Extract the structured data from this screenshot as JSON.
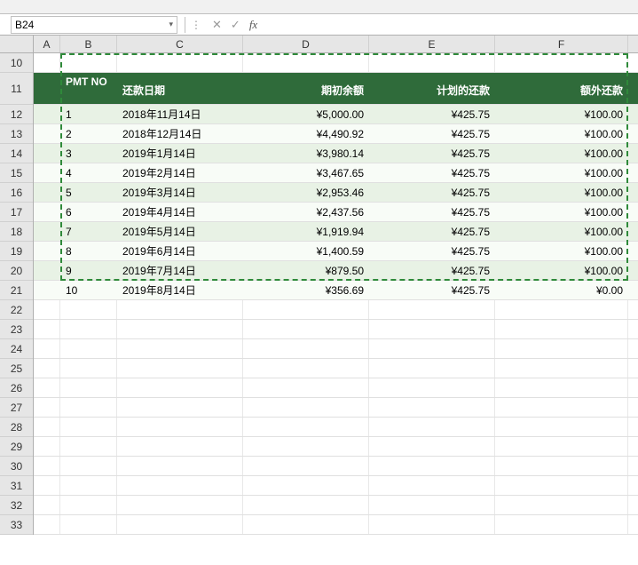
{
  "nameBox": {
    "cellRef": "B24"
  },
  "formulaBar": {
    "value": ""
  },
  "columnHeaders": {
    "A": "A",
    "B": "B",
    "C": "C",
    "D": "D",
    "E": "E",
    "F": "F"
  },
  "rowHeaders": [
    "10",
    "11",
    "12",
    "13",
    "14",
    "15",
    "16",
    "17",
    "18",
    "19",
    "20",
    "21",
    "22",
    "23",
    "24",
    "25",
    "26",
    "27",
    "28",
    "29",
    "30",
    "31",
    "32",
    "33"
  ],
  "table": {
    "headers": {
      "pmt_no": "PMT NO",
      "date": "还款日期",
      "opening": "期初余额",
      "planned": "计划的还款",
      "extra": "额外还款"
    },
    "rows": [
      {
        "no": "1",
        "date": "2018年11月14日",
        "opening": "¥5,000.00",
        "planned": "¥425.75",
        "extra": "¥100.00"
      },
      {
        "no": "2",
        "date": "2018年12月14日",
        "opening": "¥4,490.92",
        "planned": "¥425.75",
        "extra": "¥100.00"
      },
      {
        "no": "3",
        "date": "2019年1月14日",
        "opening": "¥3,980.14",
        "planned": "¥425.75",
        "extra": "¥100.00"
      },
      {
        "no": "4",
        "date": "2019年2月14日",
        "opening": "¥3,467.65",
        "planned": "¥425.75",
        "extra": "¥100.00"
      },
      {
        "no": "5",
        "date": "2019年3月14日",
        "opening": "¥2,953.46",
        "planned": "¥425.75",
        "extra": "¥100.00"
      },
      {
        "no": "6",
        "date": "2019年4月14日",
        "opening": "¥2,437.56",
        "planned": "¥425.75",
        "extra": "¥100.00"
      },
      {
        "no": "7",
        "date": "2019年5月14日",
        "opening": "¥1,919.94",
        "planned": "¥425.75",
        "extra": "¥100.00"
      },
      {
        "no": "8",
        "date": "2019年6月14日",
        "opening": "¥1,400.59",
        "planned": "¥425.75",
        "extra": "¥100.00"
      },
      {
        "no": "9",
        "date": "2019年7月14日",
        "opening": "¥879.50",
        "planned": "¥425.75",
        "extra": "¥100.00"
      },
      {
        "no": "10",
        "date": "2019年8月14日",
        "opening": "¥356.69",
        "planned": "¥425.75",
        "extra": "¥0.00"
      }
    ]
  },
  "chart_data": {
    "type": "table",
    "title": "",
    "columns": [
      "PMT NO",
      "还款日期",
      "期初余额",
      "计划的还款",
      "额外还款"
    ],
    "rows": [
      [
        1,
        "2018年11月14日",
        5000.0,
        425.75,
        100.0
      ],
      [
        2,
        "2018年12月14日",
        4490.92,
        425.75,
        100.0
      ],
      [
        3,
        "2019年1月14日",
        3980.14,
        425.75,
        100.0
      ],
      [
        4,
        "2019年2月14日",
        3467.65,
        425.75,
        100.0
      ],
      [
        5,
        "2019年3月14日",
        2953.46,
        425.75,
        100.0
      ],
      [
        6,
        "2019年4月14日",
        2437.56,
        425.75,
        100.0
      ],
      [
        7,
        "2019年5月14日",
        1919.94,
        425.75,
        100.0
      ],
      [
        8,
        "2019年6月14日",
        1400.59,
        425.75,
        100.0
      ],
      [
        9,
        "2019年7月14日",
        879.5,
        425.75,
        100.0
      ],
      [
        10,
        "2019年8月14日",
        356.69,
        425.75,
        0.0
      ]
    ]
  }
}
